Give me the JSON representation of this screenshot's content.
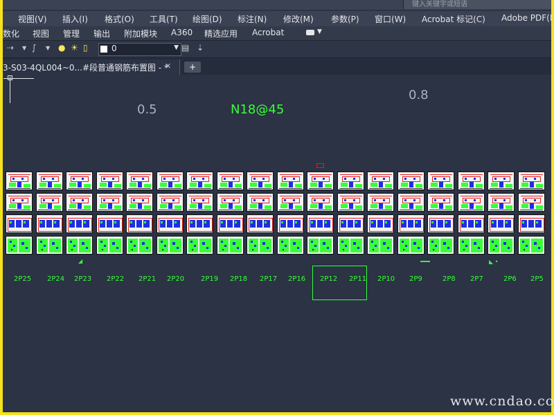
{
  "titlebar": {
    "search_placeholder": "键入关键字或短语"
  },
  "menu": [
    {
      "id": "view",
      "label": "视图(V)"
    },
    {
      "id": "insert",
      "label": "插入(I)"
    },
    {
      "id": "format",
      "label": "格式(O)"
    },
    {
      "id": "tools",
      "label": "工具(T)"
    },
    {
      "id": "draw",
      "label": "绘图(D)"
    },
    {
      "id": "dimension",
      "label": "标注(N)"
    },
    {
      "id": "modify",
      "label": "修改(M)"
    },
    {
      "id": "parametric",
      "label": "参数(P)"
    },
    {
      "id": "window",
      "label": "窗口(W)"
    },
    {
      "id": "acrobat-markup",
      "label": "Acrobat 标记(C)"
    },
    {
      "id": "adobe-pdf",
      "label": "Adobe PDF(B"
    }
  ],
  "ribbon_tabs": [
    "数化",
    "视图",
    "管理",
    "输出",
    "附加模块",
    "A360",
    "精选应用",
    "Acrobat"
  ],
  "toolbar": {
    "layer_name": "0"
  },
  "document_tab": {
    "title": "3-S03-4QL004~0...#段普通钢筋布置图 - *",
    "close": "✕",
    "new_tab": "+"
  },
  "drawing": {
    "annotations": [
      {
        "id": "scale-left",
        "text": "0.5",
        "color": "#a9b3c2"
      },
      {
        "id": "rebar-spec",
        "text": "N18@45",
        "color": "#38ff38"
      },
      {
        "id": "scale-right",
        "text": "0.8",
        "color": "#a9b3c2"
      }
    ],
    "sheet_labels": [
      "2P25",
      "2P24",
      "2P23",
      "2P22",
      "2P21",
      "2P20",
      "2P19",
      "2P18",
      "2P17",
      "2P16",
      "2P12",
      "2P11",
      "2P10",
      "2P9",
      "2P8",
      "2P7",
      "2P6",
      "2P5"
    ],
    "colors": {
      "green": "#38ff38",
      "red": "#e02020",
      "blue": "#1f2fe0",
      "paper": "#f1f3f4"
    }
  },
  "watermark": "www.cndao.com"
}
